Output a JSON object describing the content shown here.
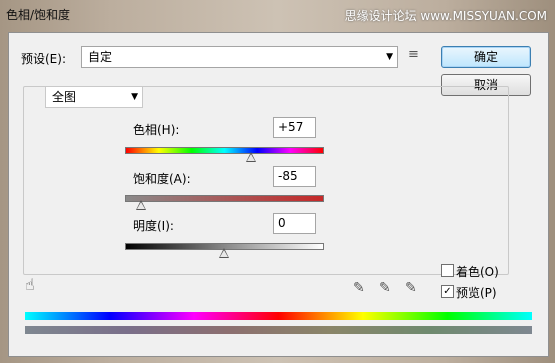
{
  "window": {
    "title": "色相/饱和度",
    "watermark": "思缘设计论坛 www.MISSYUAN.COM"
  },
  "preset": {
    "label": "预设(E):",
    "value": "自定"
  },
  "buttons": {
    "ok": "确定",
    "cancel": "取消"
  },
  "channel": {
    "value": "全图"
  },
  "hue": {
    "label": "色相(H):",
    "value": "+57",
    "level": 0.64
  },
  "saturation": {
    "label": "饱和度(A):",
    "value": "-85",
    "level": 0.08
  },
  "lightness": {
    "label": "明度(I):",
    "value": "0",
    "level": 0.5
  },
  "options": {
    "colorize": "着色(O)",
    "colorize_checked": false,
    "preview": "预览(P)",
    "preview_checked": true
  },
  "colors": {
    "accent": "#3c7fb1"
  }
}
